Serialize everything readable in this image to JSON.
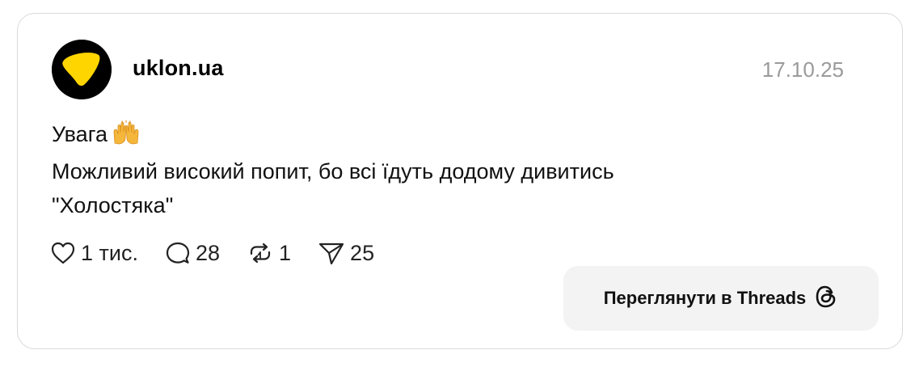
{
  "post": {
    "username": "uklon.ua",
    "date": "17.10.25",
    "text_line1": "Увага",
    "text_line2": "Можливий високий попит, бо всі їдуть додому дивитись",
    "text_line3": "\"Холостяка\"",
    "emoji": "raising-hands-icon"
  },
  "stats": {
    "likes": "1 тис.",
    "comments": "28",
    "reposts": "1",
    "shares": "25"
  },
  "cta": {
    "label": "Переглянути в Threads"
  },
  "colors": {
    "accent_yellow": "#FFD500",
    "text": "#111111",
    "muted": "#9a9a9a",
    "button_bg": "#f3f3f3",
    "border": "#d9d9d9"
  }
}
